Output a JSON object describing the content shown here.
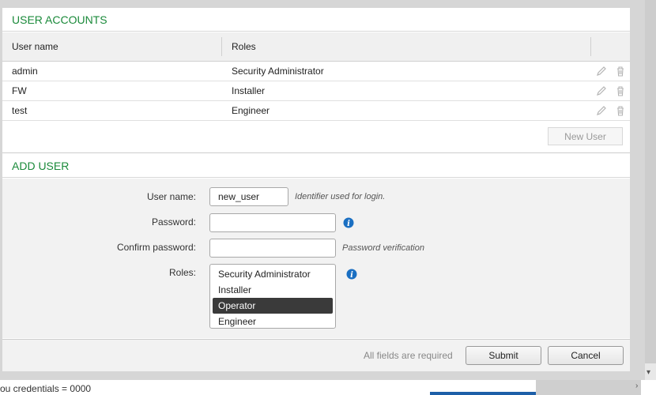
{
  "user_accounts": {
    "title": "USER ACCOUNTS",
    "columns": {
      "username": "User name",
      "roles": "Roles"
    },
    "rows": [
      {
        "username": "admin",
        "role": "Security Administrator"
      },
      {
        "username": "FW",
        "role": "Installer"
      },
      {
        "username": "test",
        "role": "Engineer"
      }
    ],
    "new_user_label": "New User"
  },
  "add_user": {
    "title": "ADD USER",
    "username_label": "User name:",
    "username_value": "new_user",
    "username_hint": "Identifier used for login.",
    "password_label": "Password:",
    "password_value": "",
    "confirm_label": "Confirm password:",
    "confirm_value": "",
    "confirm_hint": "Password verification",
    "roles_label": "Roles:",
    "roles_options": [
      "Security Administrator",
      "Installer",
      "Operator",
      "Engineer"
    ],
    "roles_selected": "Operator"
  },
  "footer": {
    "required_text": "All fields are required",
    "submit_label": "Submit",
    "cancel_label": "Cancel"
  },
  "background": {
    "partial_text": "ou credentials = 0000"
  },
  "colors": {
    "section_title": "#1a8a3a",
    "info_icon": "#1a6fc2",
    "selected_option": "#3a3a3a"
  },
  "icons": [
    "pencil-icon",
    "trash-icon",
    "info-icon",
    "chevron-right-icon"
  ]
}
